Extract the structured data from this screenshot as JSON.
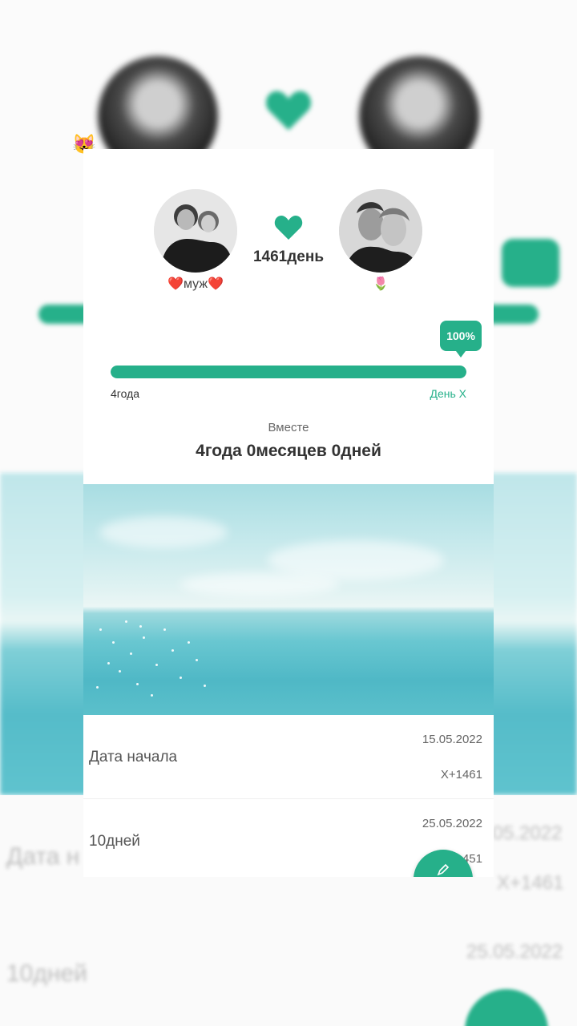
{
  "header": {
    "days_count": "1461день",
    "partner_left_name": "❤️муж❤️",
    "partner_right_name": "🌷",
    "emoji": "😻"
  },
  "progress": {
    "percent_label": "100%",
    "value": 1.0,
    "left_label": "4года",
    "right_label": "День X"
  },
  "together": {
    "label": "Вместе",
    "value": "4года 0месяцев 0дней"
  },
  "milestones": [
    {
      "title": "Дата начала",
      "date": "15.05.2022",
      "sub": "X+1461"
    },
    {
      "title": "10дней",
      "date": "25.05.2022",
      "sub": "451"
    }
  ],
  "colors": {
    "accent": "#26b08a",
    "track": "#e0e0e0",
    "text_dark": "#333333"
  },
  "icons": {
    "heart": "heart-icon",
    "fab": "pen-icon"
  }
}
